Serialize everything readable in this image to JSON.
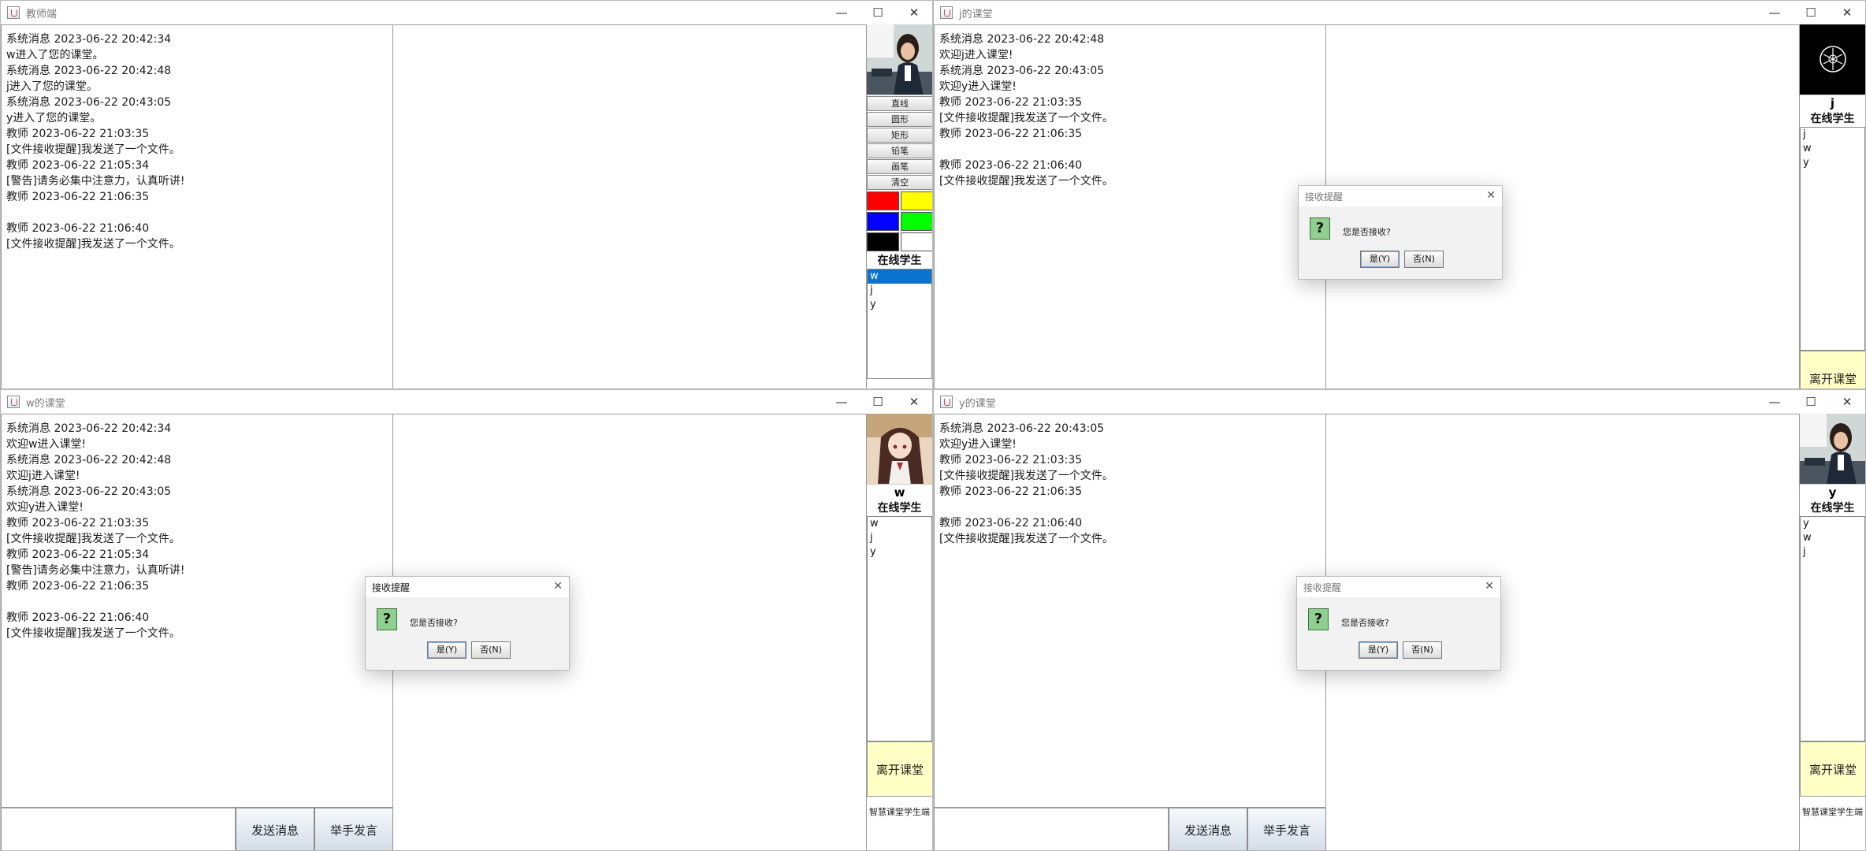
{
  "windows": {
    "teacher": {
      "title": "教师端",
      "messages": [
        "系统消息 2023-06-22 20:42:34",
        "w进入了您的课堂。",
        "系统消息 2023-06-22 20:42:48",
        "j进入了您的课堂。",
        "系统消息 2023-06-22 20:43:05",
        "y进入了您的课堂。",
        "教师 2023-06-22 21:03:35",
        "[文件接收提醒]我发送了一个文件。",
        "教师 2023-06-22 21:05:34",
        "[警告]请务必集中注意力，认真听讲!",
        "教师 2023-06-22 21:06:35",
        "",
        "教师 2023-06-22 21:06:40",
        "[文件接收提醒]我发送了一个文件。"
      ],
      "tools": [
        "直线",
        "圆形",
        "矩形",
        "铅笔",
        "画笔",
        "清空"
      ],
      "colors": [
        "#ff0000",
        "#ffff00",
        "#0000ff",
        "#00ff00",
        "#000000",
        "#ffffff"
      ],
      "online_title": "在线学生",
      "students": [
        "w",
        "j",
        "y"
      ]
    },
    "j": {
      "title": "j的课堂",
      "messages": [
        "系统消息 2023-06-22 20:42:48",
        "欢迎j进入课堂!",
        "系统消息 2023-06-22 20:43:05",
        "欢迎y进入课堂!",
        "教师 2023-06-22 21:03:35",
        "[文件接收提醒]我发送了一个文件。",
        "教师 2023-06-22 21:06:35",
        "",
        "教师 2023-06-22 21:06:40",
        "[文件接收提醒]我发送了一个文件。"
      ],
      "user_name": "j",
      "online_title": "在线学生",
      "students": [
        "j",
        "w",
        "y"
      ],
      "leave_label": "离开课堂"
    },
    "w": {
      "title": "w的课堂",
      "messages": [
        "系统消息 2023-06-22 20:42:34",
        "欢迎w进入课堂!",
        "系统消息 2023-06-22 20:42:48",
        "欢迎j进入课堂!",
        "系统消息 2023-06-22 20:43:05",
        "欢迎y进入课堂!",
        "教师 2023-06-22 21:03:35",
        "[文件接收提醒]我发送了一个文件。",
        "教师 2023-06-22 21:05:34",
        "[警告]请务必集中注意力，认真听讲!",
        "教师 2023-06-22 21:06:35",
        "",
        "教师 2023-06-22 21:06:40",
        "[文件接收提醒]我发送了一个文件。"
      ],
      "user_name": "w",
      "online_title": "在线学生",
      "students": [
        "w",
        "j",
        "y"
      ],
      "leave_label": "离开课堂",
      "send_label": "发送消息",
      "raise_label": "举手发言",
      "footer": "智慧课堂学生端"
    },
    "y": {
      "title": "y的课堂",
      "messages": [
        "系统消息 2023-06-22 20:43:05",
        "欢迎y进入课堂!",
        "教师 2023-06-22 21:03:35",
        "[文件接收提醒]我发送了一个文件。",
        "教师 2023-06-22 21:06:35",
        "",
        "教师 2023-06-22 21:06:40",
        "[文件接收提醒]我发送了一个文件。"
      ],
      "user_name": "y",
      "online_title": "在线学生",
      "students": [
        "y",
        "w",
        "j"
      ],
      "leave_label": "离开课堂",
      "send_label": "发送消息",
      "raise_label": "举手发言",
      "footer": "智慧课堂学生端"
    }
  },
  "dialog": {
    "title": "接收提醒",
    "icon": "?",
    "message": "您是否接收?",
    "yes_label": "是(Y)",
    "no_label": "否(N)"
  },
  "window_controls": {
    "minimize": "—",
    "maximize": "☐",
    "close": "✕"
  },
  "selection_color": "#0a72d1"
}
